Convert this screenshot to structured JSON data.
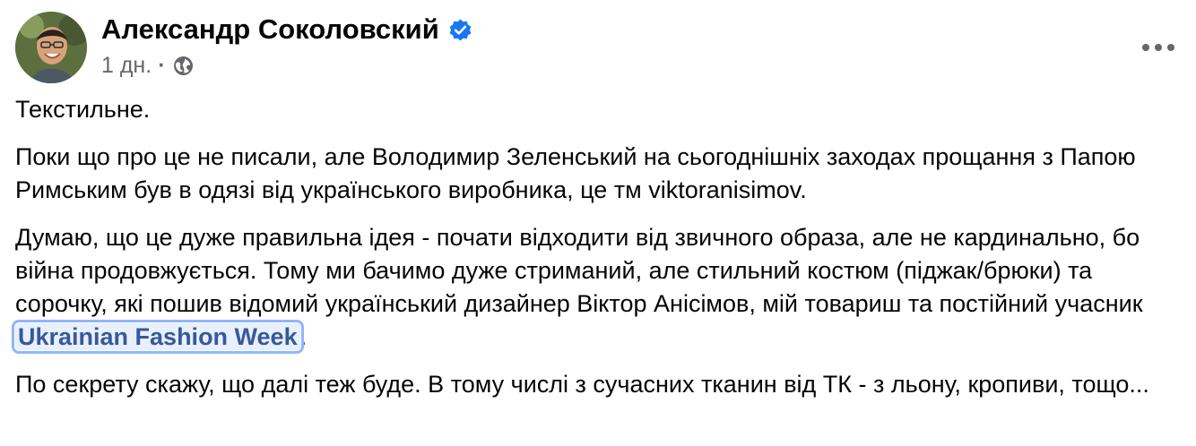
{
  "post": {
    "author": {
      "name": "Александр Соколовский",
      "verified_icon": "verified-badge-icon",
      "avatar_icon": "profile-photo"
    },
    "meta": {
      "time": "1 дн.",
      "separator": "·",
      "audience_icon": "globe-icon"
    },
    "more_icon": "more-options-icon",
    "body": {
      "paragraph_1": "Текстильне.",
      "paragraph_2": "Поки що про це не писали, але Володимир Зеленський на сьогоднішніх заходах прощання з Папою Римським був в одязі від українського виробника, це тм viktoranisimov.",
      "paragraph_3_prefix": "Думаю, що це дуже правильна ідея - почати відходити від звичного образа, але не кардинально, бо війна продовжується. Тому ми бачимо дуже стриманий, але стильний костюм (піджак/брюки) та сорочку, які пошив відомий український дизайнер Віктор Анісімов, мій товариш та постійний учасник ",
      "paragraph_3_link": "Ukrainian Fashion Week",
      "paragraph_3_suffix": ".",
      "paragraph_4": "По секрету скажу, що далі теж буде. В тому числі з сучасних тканин від ТК - з льону, кропиви, тощо..."
    }
  },
  "colors": {
    "text": "#050505",
    "secondary": "#65676b",
    "verified": "#1877f2",
    "link": "#385898"
  }
}
